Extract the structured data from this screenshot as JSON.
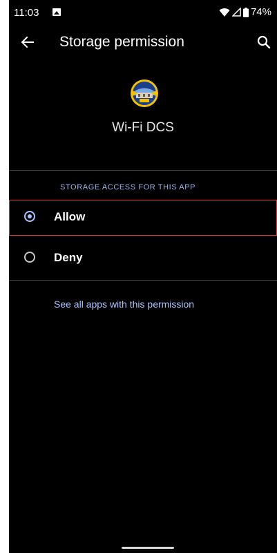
{
  "status_bar": {
    "time": "11:03",
    "battery": "74%",
    "icons": [
      "notification-icon",
      "wifi-icon",
      "signal-icon",
      "battery-icon"
    ]
  },
  "app_bar": {
    "title": "Storage permission",
    "back_icon": "arrow-left-icon",
    "search_icon": "search-icon"
  },
  "app": {
    "name": "Wi-Fi DCS",
    "icon": "app-logo-icon"
  },
  "permission": {
    "section_label": "STORAGE ACCESS FOR THIS APP",
    "options": [
      {
        "label": "Allow",
        "checked": true
      },
      {
        "label": "Deny",
        "checked": false
      }
    ],
    "see_all_link": "See all apps with this permission"
  },
  "colors": {
    "background": "#000000",
    "accent": "#a8c4ff",
    "highlight": "#e0343a"
  }
}
